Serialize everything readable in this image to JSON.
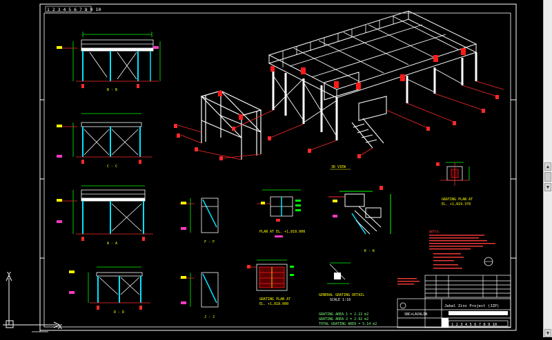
{
  "drawing": {
    "top_ruler": "1 2 3 4 5 6 7 8 9 10",
    "bottom_ruler": "1 2 3 4 5 6 7 8 9 10",
    "sections": {
      "b_b": "B - B",
      "c_c": "C - C",
      "a_a": "A - A",
      "d_d": "D - D",
      "f_f": "F - F",
      "j_j": "J - J",
      "k_k": "K - K"
    },
    "view_3d": "3D  VIEW",
    "plan_at": "PLAN  AT  EL.  +1,818.000",
    "grating_plan_1": "GRATING  PLAN  AT",
    "grating_plan_1_el": "EL.  +1,819.370",
    "grating_plan_2": "GRATING  PLAN  AT",
    "grating_plan_2_el": "EL.  +1,818.000",
    "grating_detail": "GENERAL  GRATING  DETAIL",
    "grating_scale": "SCALE 1:10",
    "grating_area_1": "GRATING  AREA 1  =     2.22  m2",
    "grating_area_2": "GRATING  AREA 2  =     2.92  m2",
    "grating_area_total": "TOTAL  GRATING  AREA  =    5.14  m2",
    "notes_title": "NOTES:",
    "title_block_project": "Jabal Zinc Project (JZP)",
    "title_block_company": "SNC+LAVALIN"
  },
  "ucs": {
    "x_label": "X",
    "y_label": "Y"
  },
  "colors": {
    "background": "#000000",
    "structure": "#ffffff",
    "gridline": "#ff2a2a",
    "dimension": "#00ff00",
    "annotation_green": "#7fff7f",
    "label_yellow": "#ffff00",
    "tag_magenta": "#ff3bc4",
    "member_cyan": "#00e5ff",
    "column_red": "#ff1a1a",
    "scrollbar": "#ececec"
  },
  "scrollbar": {
    "up_icon": "scroll-up-arrow-icon",
    "down_icon": "scroll-down-arrow-icon"
  }
}
